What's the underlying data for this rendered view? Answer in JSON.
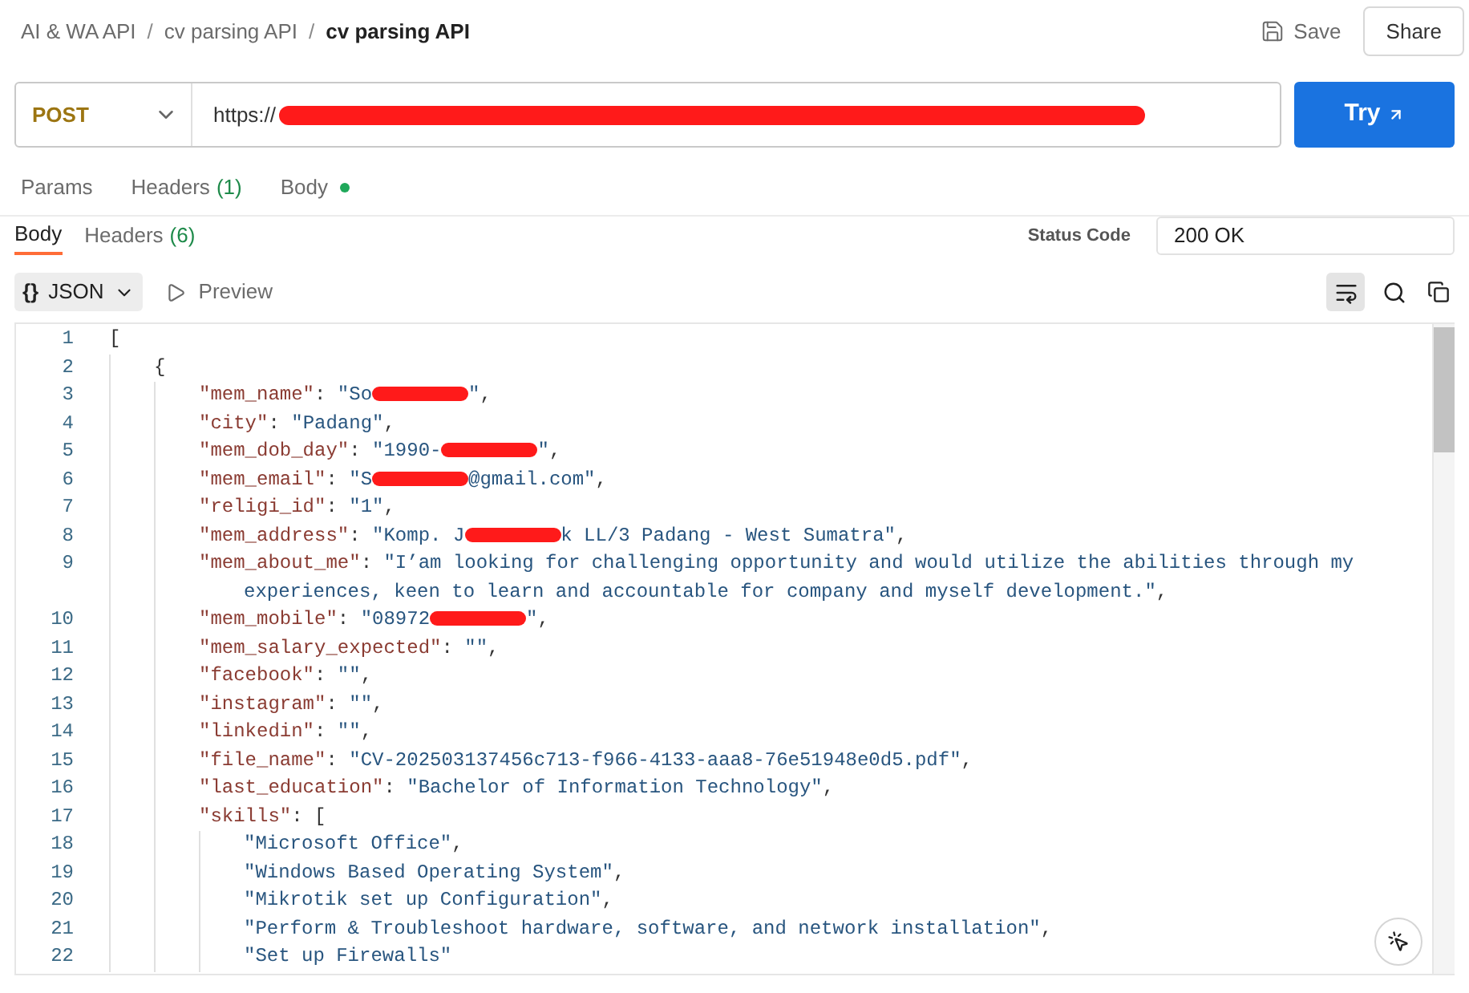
{
  "breadcrumb": [
    {
      "label": "AI & WA API",
      "sep": "/",
      "current": false
    },
    {
      "label": "cv parsing API",
      "sep": "/",
      "current": false
    },
    {
      "label": "cv parsing API",
      "current": true
    }
  ],
  "actions": {
    "save": "Save",
    "share": "Share"
  },
  "request": {
    "method": "POST",
    "url_parts": [
      {
        "kind": "text",
        "text": "https://"
      },
      {
        "kind": "redacted"
      }
    ],
    "send": "Try"
  },
  "request_tabs": [
    {
      "label": "Params",
      "selected": false
    },
    {
      "label": "Headers",
      "count": "(1)",
      "selected": false
    },
    {
      "label": "Body",
      "indicator": true,
      "selected": false
    }
  ],
  "response_tabs": [
    {
      "label": "Body",
      "selected": true
    },
    {
      "label": "Headers",
      "count": "(6)",
      "selected": false
    }
  ],
  "status": {
    "label": "Status Code",
    "value": "200 OK"
  },
  "view": {
    "format_icon": "{}",
    "format": "JSON",
    "preview": "Preview",
    "wrap_on": true
  },
  "code": [
    {
      "num": "1",
      "tokens": [
        {
          "kind": "punct",
          "text": "["
        }
      ],
      "children": [
        {
          "num": "2",
          "tokens": [
            {
              "kind": "punct",
              "text": "{"
            }
          ],
          "children": [
            {
              "num": "3",
              "tokens": [
                {
                  "kind": "key",
                  "text": "\"mem_name\""
                },
                {
                  "kind": "punct",
                  "text": ": "
                },
                {
                  "kind": "str",
                  "text": "\"So"
                },
                {
                  "kind": "redacted"
                },
                {
                  "kind": "str",
                  "text": "\""
                },
                {
                  "kind": "punct",
                  "text": ","
                }
              ]
            },
            {
              "num": "4",
              "tokens": [
                {
                  "kind": "key",
                  "text": "\"city\""
                },
                {
                  "kind": "punct",
                  "text": ": "
                },
                {
                  "kind": "str",
                  "text": "\"Padang\""
                },
                {
                  "kind": "punct",
                  "text": ","
                }
              ]
            },
            {
              "num": "5",
              "tokens": [
                {
                  "kind": "key",
                  "text": "\"mem_dob_day\""
                },
                {
                  "kind": "punct",
                  "text": ": "
                },
                {
                  "kind": "str",
                  "text": "\"1990-"
                },
                {
                  "kind": "redacted"
                },
                {
                  "kind": "str",
                  "text": "\""
                },
                {
                  "kind": "punct",
                  "text": ","
                }
              ]
            },
            {
              "num": "6",
              "tokens": [
                {
                  "kind": "key",
                  "text": "\"mem_email\""
                },
                {
                  "kind": "punct",
                  "text": ": "
                },
                {
                  "kind": "str",
                  "text": "\"S"
                },
                {
                  "kind": "redacted"
                },
                {
                  "kind": "str",
                  "text": "@gmail.com\""
                },
                {
                  "kind": "punct",
                  "text": ","
                }
              ]
            },
            {
              "num": "7",
              "tokens": [
                {
                  "kind": "key",
                  "text": "\"religi_id\""
                },
                {
                  "kind": "punct",
                  "text": ": "
                },
                {
                  "kind": "str",
                  "text": "\"1\""
                },
                {
                  "kind": "punct",
                  "text": ","
                }
              ]
            },
            {
              "num": "8",
              "tokens": [
                {
                  "kind": "key",
                  "text": "\"mem_address\""
                },
                {
                  "kind": "punct",
                  "text": ": "
                },
                {
                  "kind": "str",
                  "text": "\"Komp. J"
                },
                {
                  "kind": "redacted"
                },
                {
                  "kind": "str",
                  "text": "k LL/3 Padang - West Sumatra\""
                },
                {
                  "kind": "punct",
                  "text": ","
                }
              ]
            },
            {
              "num": "9",
              "tokens": [
                {
                  "kind": "key",
                  "text": "\"mem_about_me\""
                },
                {
                  "kind": "punct",
                  "text": ": "
                },
                {
                  "kind": "str",
                  "text": "\"I’am looking for challenging opportunity and would utilize the abilities through my experiences, keen to learn and accountable for company and myself development.\""
                },
                {
                  "kind": "punct",
                  "text": ","
                }
              ]
            },
            {
              "num": "10",
              "tokens": [
                {
                  "kind": "key",
                  "text": "\"mem_mobile\""
                },
                {
                  "kind": "punct",
                  "text": ": "
                },
                {
                  "kind": "str",
                  "text": "\"08972"
                },
                {
                  "kind": "redacted"
                },
                {
                  "kind": "str",
                  "text": "\""
                },
                {
                  "kind": "punct",
                  "text": ","
                }
              ]
            },
            {
              "num": "11",
              "tokens": [
                {
                  "kind": "key",
                  "text": "\"mem_salary_expected\""
                },
                {
                  "kind": "punct",
                  "text": ": "
                },
                {
                  "kind": "str",
                  "text": "\"\""
                },
                {
                  "kind": "punct",
                  "text": ","
                }
              ]
            },
            {
              "num": "12",
              "tokens": [
                {
                  "kind": "key",
                  "text": "\"facebook\""
                },
                {
                  "kind": "punct",
                  "text": ": "
                },
                {
                  "kind": "str",
                  "text": "\"\""
                },
                {
                  "kind": "punct",
                  "text": ","
                }
              ]
            },
            {
              "num": "13",
              "tokens": [
                {
                  "kind": "key",
                  "text": "\"instagram\""
                },
                {
                  "kind": "punct",
                  "text": ": "
                },
                {
                  "kind": "str",
                  "text": "\"\""
                },
                {
                  "kind": "punct",
                  "text": ","
                }
              ]
            },
            {
              "num": "14",
              "tokens": [
                {
                  "kind": "key",
                  "text": "\"linkedin\""
                },
                {
                  "kind": "punct",
                  "text": ": "
                },
                {
                  "kind": "str",
                  "text": "\"\""
                },
                {
                  "kind": "punct",
                  "text": ","
                }
              ]
            },
            {
              "num": "15",
              "tokens": [
                {
                  "kind": "key",
                  "text": "\"file_name\""
                },
                {
                  "kind": "punct",
                  "text": ": "
                },
                {
                  "kind": "str",
                  "text": "\"CV-202503137456c713-f966-4133-aaa8-76e51948e0d5.pdf\""
                },
                {
                  "kind": "punct",
                  "text": ","
                }
              ]
            },
            {
              "num": "16",
              "tokens": [
                {
                  "kind": "key",
                  "text": "\"last_education\""
                },
                {
                  "kind": "punct",
                  "text": ": "
                },
                {
                  "kind": "str",
                  "text": "\"Bachelor of Information Technology\""
                },
                {
                  "kind": "punct",
                  "text": ","
                }
              ]
            },
            {
              "num": "17",
              "tokens": [
                {
                  "kind": "key",
                  "text": "\"skills\""
                },
                {
                  "kind": "punct",
                  "text": ": ["
                }
              ],
              "children": [
                {
                  "num": "18",
                  "tokens": [
                    {
                      "kind": "str",
                      "text": "\"Microsoft Office\""
                    },
                    {
                      "kind": "punct",
                      "text": ","
                    }
                  ]
                },
                {
                  "num": "19",
                  "tokens": [
                    {
                      "kind": "str",
                      "text": "\"Windows Based Operating System\""
                    },
                    {
                      "kind": "punct",
                      "text": ","
                    }
                  ]
                },
                {
                  "num": "20",
                  "tokens": [
                    {
                      "kind": "str",
                      "text": "\"Mikrotik set up Configuration\""
                    },
                    {
                      "kind": "punct",
                      "text": ","
                    }
                  ]
                },
                {
                  "num": "21",
                  "tokens": [
                    {
                      "kind": "str",
                      "text": "\"Perform & Troubleshoot hardware, software, and network installation\""
                    },
                    {
                      "kind": "punct",
                      "text": ","
                    }
                  ]
                },
                {
                  "num": "22",
                  "tokens": [
                    {
                      "kind": "str",
                      "text": "\"Set up Firewalls\""
                    }
                  ]
                }
              ]
            }
          ]
        }
      ]
    }
  ]
}
